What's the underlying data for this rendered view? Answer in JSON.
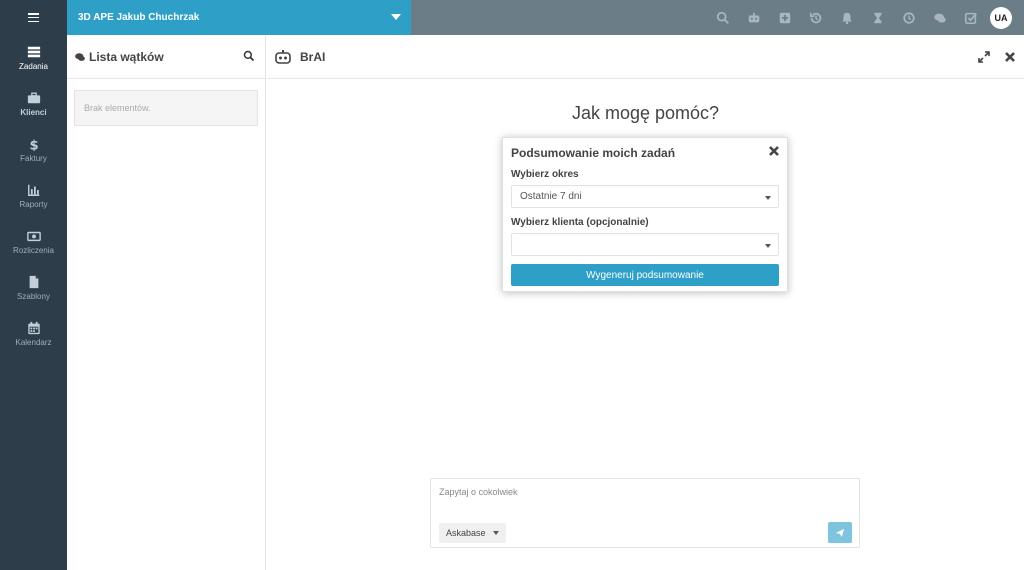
{
  "topbar": {
    "company_name": "3D APE Jakub Chuchrzak",
    "avatar_initials": "UA",
    "icons": [
      "search-icon",
      "robot-icon",
      "plus-square-icon",
      "history-icon",
      "bell-icon",
      "hourglass-icon",
      "clock-icon",
      "chat-icon",
      "checkbox-icon"
    ]
  },
  "sidebar": {
    "items": [
      {
        "label": "Zadania",
        "icon": "tasks-icon"
      },
      {
        "label": "Klienci",
        "icon": "briefcase-icon"
      },
      {
        "label": "Faktury",
        "icon": "dollar-icon"
      },
      {
        "label": "Raporty",
        "icon": "bar-chart-icon"
      },
      {
        "label": "Rozliczenia",
        "icon": "money-icon"
      },
      {
        "label": "Szablony",
        "icon": "file-icon"
      },
      {
        "label": "Kalendarz",
        "icon": "calendar-icon"
      }
    ]
  },
  "threads": {
    "title": "Lista wątków",
    "empty_text": "Brak elementów."
  },
  "chat": {
    "title": "BrAI",
    "greeting": "Jak mogę pomóc?",
    "input_placeholder": "Zapytaj o cokolwiek",
    "kb_select_value": "Askabase"
  },
  "modal": {
    "title": "Podsumowanie moich zadań",
    "period_label": "Wybierz okres",
    "period_value": "Ostatnie 7 dni",
    "client_label": "Wybierz klienta (opcjonalnie)",
    "client_value": "",
    "generate_label": "Wygeneruj podsumowanie"
  },
  "colors": {
    "accent": "#2ea0c7",
    "sidebar_bg": "#2d3e4a",
    "topbar_bg": "#6b7d87"
  }
}
